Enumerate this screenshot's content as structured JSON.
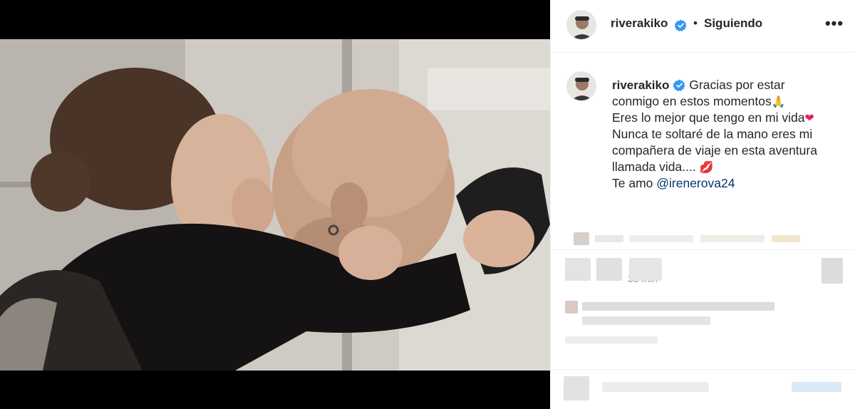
{
  "post": {
    "username": "riverakiko",
    "follow_status": "Siguiendo",
    "dot": "•",
    "more": "•••",
    "caption_lines": [
      "Gracias por estar",
      "conmigo en estos momentos",
      "Eres lo mejor que tengo en mi vida",
      "Nunca te soltaré de la mano eres mi",
      "compañera de viaje en esta aventura",
      "llamada vida...."
    ],
    "caption_last_prefix": "Te amo ",
    "mention": "@irenerova24",
    "time": "38 min",
    "emoji": {
      "pray": "🙏",
      "heart": "❤",
      "kiss": "💋"
    }
  },
  "colors": {
    "verified_blue": "#3897f0",
    "mention_blue": "#00376b",
    "text": "#262626",
    "muted": "#8e8e8e",
    "divider": "#efefef"
  },
  "icons": [
    "verified-badge-icon",
    "more-options-icon",
    "user-avatar"
  ]
}
